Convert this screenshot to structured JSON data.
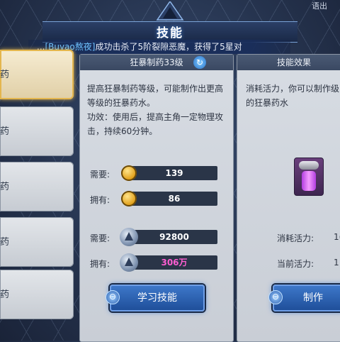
{
  "window": {
    "title": "技能",
    "top_right_partial": "语出"
  },
  "marquee": {
    "prefix": "...",
    "player": "[Buyao熬夜]",
    "message": "成功击杀了5阶裂隙恶魔，获得了5星对"
  },
  "skill_list": [
    {
      "label": "药",
      "selected": true
    },
    {
      "label": "药",
      "selected": false
    },
    {
      "label": "药",
      "selected": false
    },
    {
      "label": "药",
      "selected": false
    },
    {
      "label": "药",
      "selected": false
    }
  ],
  "skill_panel": {
    "header": "狂暴制药33级",
    "description_1": "提高狂暴制药等级，可能制作出更高等级的狂暴药水。",
    "description_2": "功效：使用后，提高主角一定物理攻击，持续60分钟。",
    "gold_need_label": "需要:",
    "gold_need_value": "139",
    "gold_have_label": "拥有:",
    "gold_have_value": "86",
    "crystal_need_label": "需要:",
    "crystal_need_value": "92800",
    "crystal_have_label": "拥有:",
    "crystal_have_value": "306万",
    "learn_button": "学习技能"
  },
  "effect_panel": {
    "header": "技能效果",
    "description": "消耗活力，你可以制作级的狂暴药水",
    "cost_label": "消耗活力:",
    "cost_value": "1(",
    "current_label": "当前活力:",
    "current_value": "1",
    "make_button": "制作"
  },
  "colors": {
    "accent_blue": "#2f6bc0",
    "pink_value": "#ff5ed2",
    "selected_gold": "#e4b64e"
  }
}
